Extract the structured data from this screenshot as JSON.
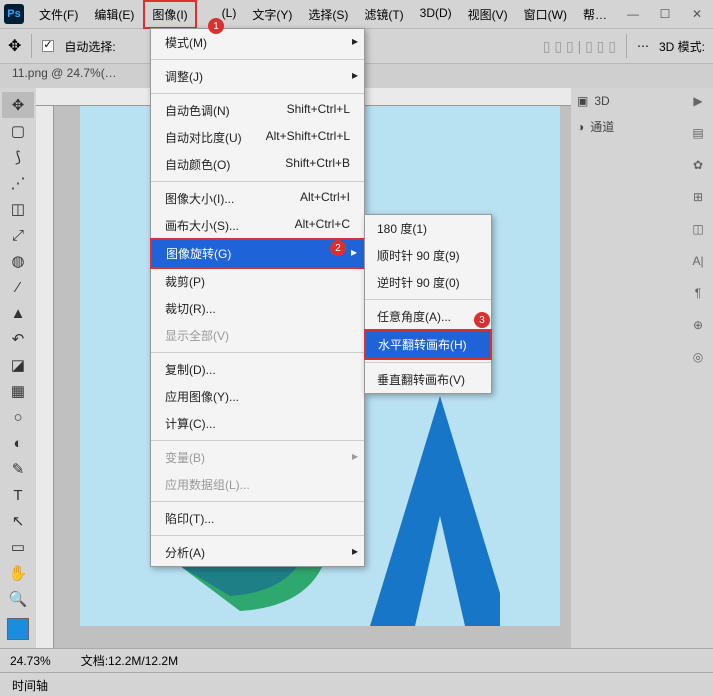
{
  "menubar": [
    "文件(F)",
    "编辑(E)",
    "图像(I)",
    "",
    "(L)",
    "文字(Y)",
    "选择(S)",
    "滤镜(T)",
    "3D(D)",
    "视图(V)",
    "窗口(W)",
    "帮…"
  ],
  "optbar": {
    "auto": "自动选择:",
    "mode3d": "3D 模式:"
  },
  "doctab": "11.png @ 24.7%(…",
  "dropdown": [
    {
      "l": "模式(M)",
      "a": true
    },
    {
      "sep": 1
    },
    {
      "l": "调整(J)",
      "a": true
    },
    {
      "sep": 1
    },
    {
      "l": "自动色调(N)",
      "s": "Shift+Ctrl+L"
    },
    {
      "l": "自动对比度(U)",
      "s": "Alt+Shift+Ctrl+L"
    },
    {
      "l": "自动颜色(O)",
      "s": "Shift+Ctrl+B"
    },
    {
      "sep": 1
    },
    {
      "l": "图像大小(I)...",
      "s": "Alt+Ctrl+I"
    },
    {
      "l": "画布大小(S)...",
      "s": "Alt+Ctrl+C"
    },
    {
      "l": "图像旋转(G)",
      "a": true,
      "hl": true
    },
    {
      "l": "裁剪(P)"
    },
    {
      "l": "裁切(R)..."
    },
    {
      "l": "显示全部(V)",
      "d": true
    },
    {
      "sep": 1
    },
    {
      "l": "复制(D)..."
    },
    {
      "l": "应用图像(Y)..."
    },
    {
      "l": "计算(C)..."
    },
    {
      "sep": 1
    },
    {
      "l": "变量(B)",
      "a": true,
      "d": true
    },
    {
      "l": "应用数据组(L)...",
      "d": true
    },
    {
      "sep": 1
    },
    {
      "l": "陷印(T)..."
    },
    {
      "sep": 1
    },
    {
      "l": "分析(A)",
      "a": true
    }
  ],
  "submenu": [
    "180 度(1)",
    "顺时针 90 度(9)",
    "逆时针 90 度(0)",
    "任意角度(A)...",
    "水平翻转画布(H)",
    "垂直翻转画布(V)"
  ],
  "rpanel": {
    "a": "3D",
    "b": "通道"
  },
  "status": {
    "zoom": "24.73%",
    "doc": "文档:12.2M/12.2M"
  },
  "timeline": "时间轴",
  "badges": [
    "1",
    "2",
    "3"
  ]
}
